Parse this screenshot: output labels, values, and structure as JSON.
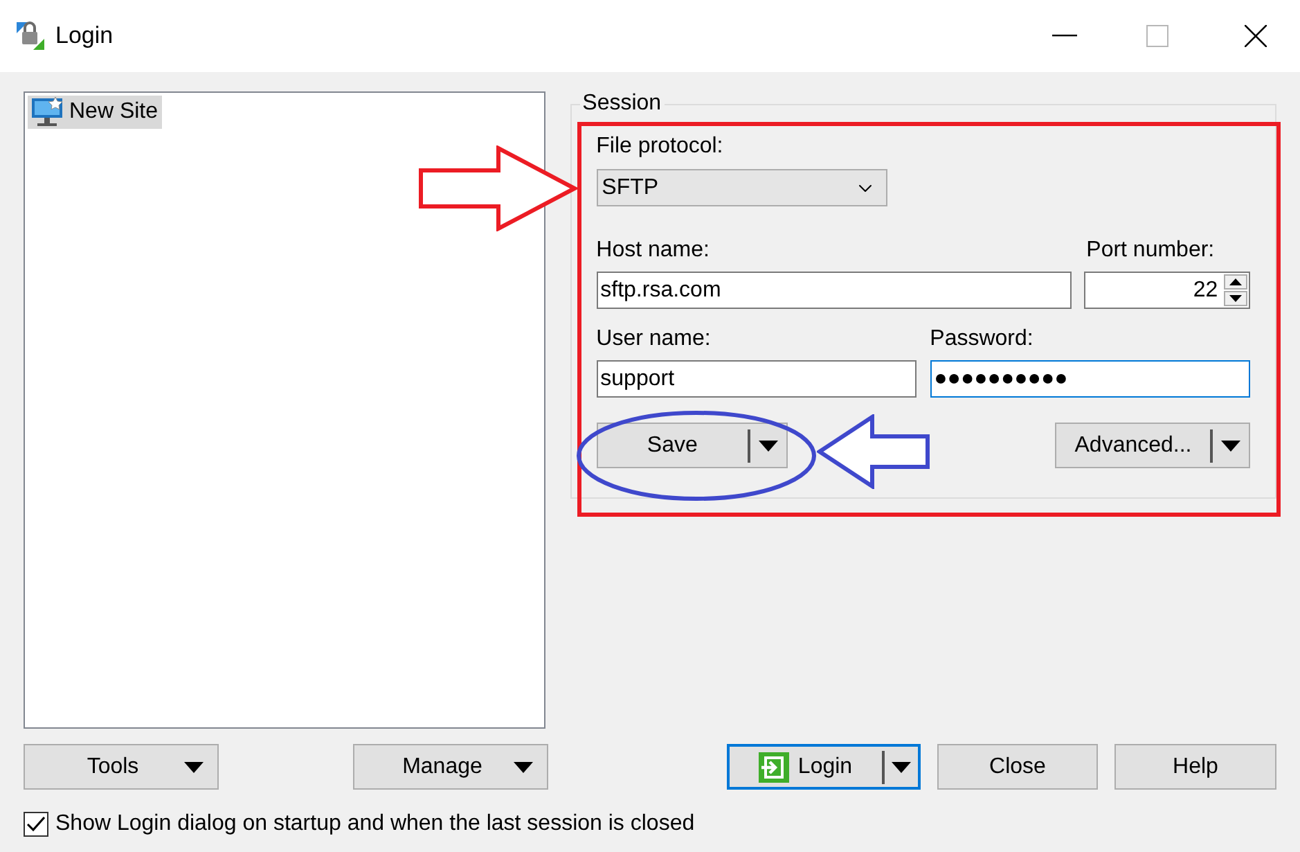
{
  "window": {
    "title": "Login"
  },
  "sites": [
    {
      "label": "New Site",
      "selected": true
    }
  ],
  "session": {
    "title": "Session",
    "file_protocol": {
      "label": "File protocol:",
      "value": "SFTP"
    },
    "host": {
      "label": "Host name:",
      "value": "sftp.rsa.com"
    },
    "port": {
      "label": "Port number:",
      "value": "22"
    },
    "user": {
      "label": "User name:",
      "value": "support",
      "focused": false
    },
    "password": {
      "label": "Password:",
      "value": "●●●●●●●●●●",
      "focused": true
    },
    "buttons": [
      {
        "label": "Save",
        "kind": "split"
      },
      {
        "label": "Advanced...",
        "kind": "split"
      }
    ]
  },
  "bottom_buttons": [
    {
      "label": "Tools",
      "kind": "menu"
    },
    {
      "label": "Manage",
      "kind": "menu"
    },
    {
      "label": "Login",
      "kind": "default-split"
    },
    {
      "label": "Close",
      "kind": "plain"
    },
    {
      "label": "Help",
      "kind": "plain"
    }
  ],
  "startup_option": {
    "label": "Show Login dialog on startup and when the last session is closed",
    "checked": true
  }
}
